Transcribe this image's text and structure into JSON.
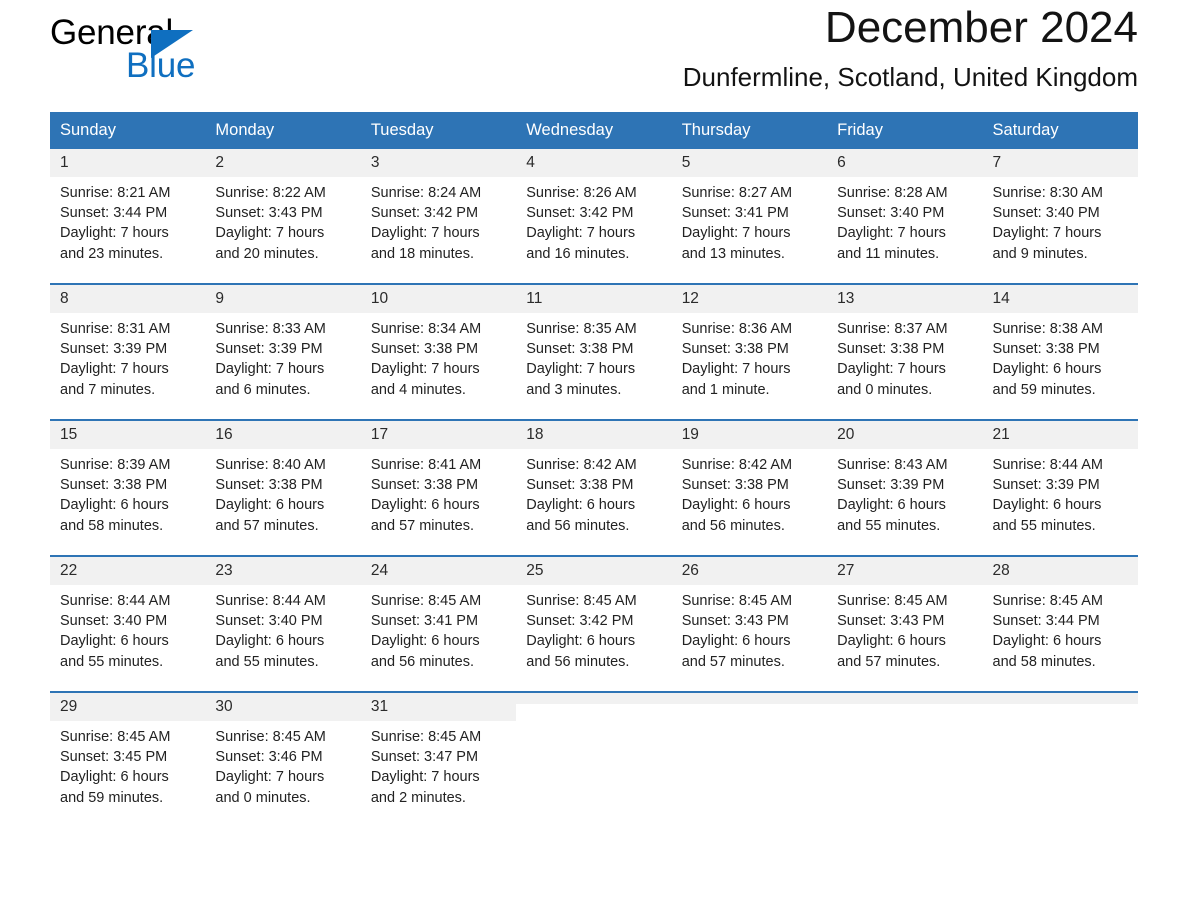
{
  "brand": {
    "name_part1": "General",
    "name_part2": "Blue",
    "triangle_icon": "triangle-icon",
    "accent_color": "#0f6fc0"
  },
  "header": {
    "month_title": "December 2024",
    "location": "Dunfermline, Scotland, United Kingdom"
  },
  "theme": {
    "header_blue": "#2e74b5",
    "daynum_band": "#f1f1f1",
    "text": "#222222"
  },
  "calendar": {
    "weekday_headers": [
      "Sunday",
      "Monday",
      "Tuesday",
      "Wednesday",
      "Thursday",
      "Friday",
      "Saturday"
    ],
    "weeks": [
      [
        {
          "day": "1",
          "sunrise": "Sunrise: 8:21 AM",
          "sunset": "Sunset: 3:44 PM",
          "daylight_line1": "Daylight: 7 hours",
          "daylight_line2": "and 23 minutes."
        },
        {
          "day": "2",
          "sunrise": "Sunrise: 8:22 AM",
          "sunset": "Sunset: 3:43 PM",
          "daylight_line1": "Daylight: 7 hours",
          "daylight_line2": "and 20 minutes."
        },
        {
          "day": "3",
          "sunrise": "Sunrise: 8:24 AM",
          "sunset": "Sunset: 3:42 PM",
          "daylight_line1": "Daylight: 7 hours",
          "daylight_line2": "and 18 minutes."
        },
        {
          "day": "4",
          "sunrise": "Sunrise: 8:26 AM",
          "sunset": "Sunset: 3:42 PM",
          "daylight_line1": "Daylight: 7 hours",
          "daylight_line2": "and 16 minutes."
        },
        {
          "day": "5",
          "sunrise": "Sunrise: 8:27 AM",
          "sunset": "Sunset: 3:41 PM",
          "daylight_line1": "Daylight: 7 hours",
          "daylight_line2": "and 13 minutes."
        },
        {
          "day": "6",
          "sunrise": "Sunrise: 8:28 AM",
          "sunset": "Sunset: 3:40 PM",
          "daylight_line1": "Daylight: 7 hours",
          "daylight_line2": "and 11 minutes."
        },
        {
          "day": "7",
          "sunrise": "Sunrise: 8:30 AM",
          "sunset": "Sunset: 3:40 PM",
          "daylight_line1": "Daylight: 7 hours",
          "daylight_line2": "and 9 minutes."
        }
      ],
      [
        {
          "day": "8",
          "sunrise": "Sunrise: 8:31 AM",
          "sunset": "Sunset: 3:39 PM",
          "daylight_line1": "Daylight: 7 hours",
          "daylight_line2": "and 7 minutes."
        },
        {
          "day": "9",
          "sunrise": "Sunrise: 8:33 AM",
          "sunset": "Sunset: 3:39 PM",
          "daylight_line1": "Daylight: 7 hours",
          "daylight_line2": "and 6 minutes."
        },
        {
          "day": "10",
          "sunrise": "Sunrise: 8:34 AM",
          "sunset": "Sunset: 3:38 PM",
          "daylight_line1": "Daylight: 7 hours",
          "daylight_line2": "and 4 minutes."
        },
        {
          "day": "11",
          "sunrise": "Sunrise: 8:35 AM",
          "sunset": "Sunset: 3:38 PM",
          "daylight_line1": "Daylight: 7 hours",
          "daylight_line2": "and 3 minutes."
        },
        {
          "day": "12",
          "sunrise": "Sunrise: 8:36 AM",
          "sunset": "Sunset: 3:38 PM",
          "daylight_line1": "Daylight: 7 hours",
          "daylight_line2": "and 1 minute."
        },
        {
          "day": "13",
          "sunrise": "Sunrise: 8:37 AM",
          "sunset": "Sunset: 3:38 PM",
          "daylight_line1": "Daylight: 7 hours",
          "daylight_line2": "and 0 minutes."
        },
        {
          "day": "14",
          "sunrise": "Sunrise: 8:38 AM",
          "sunset": "Sunset: 3:38 PM",
          "daylight_line1": "Daylight: 6 hours",
          "daylight_line2": "and 59 minutes."
        }
      ],
      [
        {
          "day": "15",
          "sunrise": "Sunrise: 8:39 AM",
          "sunset": "Sunset: 3:38 PM",
          "daylight_line1": "Daylight: 6 hours",
          "daylight_line2": "and 58 minutes."
        },
        {
          "day": "16",
          "sunrise": "Sunrise: 8:40 AM",
          "sunset": "Sunset: 3:38 PM",
          "daylight_line1": "Daylight: 6 hours",
          "daylight_line2": "and 57 minutes."
        },
        {
          "day": "17",
          "sunrise": "Sunrise: 8:41 AM",
          "sunset": "Sunset: 3:38 PM",
          "daylight_line1": "Daylight: 6 hours",
          "daylight_line2": "and 57 minutes."
        },
        {
          "day": "18",
          "sunrise": "Sunrise: 8:42 AM",
          "sunset": "Sunset: 3:38 PM",
          "daylight_line1": "Daylight: 6 hours",
          "daylight_line2": "and 56 minutes."
        },
        {
          "day": "19",
          "sunrise": "Sunrise: 8:42 AM",
          "sunset": "Sunset: 3:38 PM",
          "daylight_line1": "Daylight: 6 hours",
          "daylight_line2": "and 56 minutes."
        },
        {
          "day": "20",
          "sunrise": "Sunrise: 8:43 AM",
          "sunset": "Sunset: 3:39 PM",
          "daylight_line1": "Daylight: 6 hours",
          "daylight_line2": "and 55 minutes."
        },
        {
          "day": "21",
          "sunrise": "Sunrise: 8:44 AM",
          "sunset": "Sunset: 3:39 PM",
          "daylight_line1": "Daylight: 6 hours",
          "daylight_line2": "and 55 minutes."
        }
      ],
      [
        {
          "day": "22",
          "sunrise": "Sunrise: 8:44 AM",
          "sunset": "Sunset: 3:40 PM",
          "daylight_line1": "Daylight: 6 hours",
          "daylight_line2": "and 55 minutes."
        },
        {
          "day": "23",
          "sunrise": "Sunrise: 8:44 AM",
          "sunset": "Sunset: 3:40 PM",
          "daylight_line1": "Daylight: 6 hours",
          "daylight_line2": "and 55 minutes."
        },
        {
          "day": "24",
          "sunrise": "Sunrise: 8:45 AM",
          "sunset": "Sunset: 3:41 PM",
          "daylight_line1": "Daylight: 6 hours",
          "daylight_line2": "and 56 minutes."
        },
        {
          "day": "25",
          "sunrise": "Sunrise: 8:45 AM",
          "sunset": "Sunset: 3:42 PM",
          "daylight_line1": "Daylight: 6 hours",
          "daylight_line2": "and 56 minutes."
        },
        {
          "day": "26",
          "sunrise": "Sunrise: 8:45 AM",
          "sunset": "Sunset: 3:43 PM",
          "daylight_line1": "Daylight: 6 hours",
          "daylight_line2": "and 57 minutes."
        },
        {
          "day": "27",
          "sunrise": "Sunrise: 8:45 AM",
          "sunset": "Sunset: 3:43 PM",
          "daylight_line1": "Daylight: 6 hours",
          "daylight_line2": "and 57 minutes."
        },
        {
          "day": "28",
          "sunrise": "Sunrise: 8:45 AM",
          "sunset": "Sunset: 3:44 PM",
          "daylight_line1": "Daylight: 6 hours",
          "daylight_line2": "and 58 minutes."
        }
      ],
      [
        {
          "day": "29",
          "sunrise": "Sunrise: 8:45 AM",
          "sunset": "Sunset: 3:45 PM",
          "daylight_line1": "Daylight: 6 hours",
          "daylight_line2": "and 59 minutes."
        },
        {
          "day": "30",
          "sunrise": "Sunrise: 8:45 AM",
          "sunset": "Sunset: 3:46 PM",
          "daylight_line1": "Daylight: 7 hours",
          "daylight_line2": "and 0 minutes."
        },
        {
          "day": "31",
          "sunrise": "Sunrise: 8:45 AM",
          "sunset": "Sunset: 3:47 PM",
          "daylight_line1": "Daylight: 7 hours",
          "daylight_line2": "and 2 minutes."
        },
        {
          "day": "",
          "sunrise": "",
          "sunset": "",
          "daylight_line1": "",
          "daylight_line2": ""
        },
        {
          "day": "",
          "sunrise": "",
          "sunset": "",
          "daylight_line1": "",
          "daylight_line2": ""
        },
        {
          "day": "",
          "sunrise": "",
          "sunset": "",
          "daylight_line1": "",
          "daylight_line2": ""
        },
        {
          "day": "",
          "sunrise": "",
          "sunset": "",
          "daylight_line1": "",
          "daylight_line2": ""
        }
      ]
    ]
  }
}
